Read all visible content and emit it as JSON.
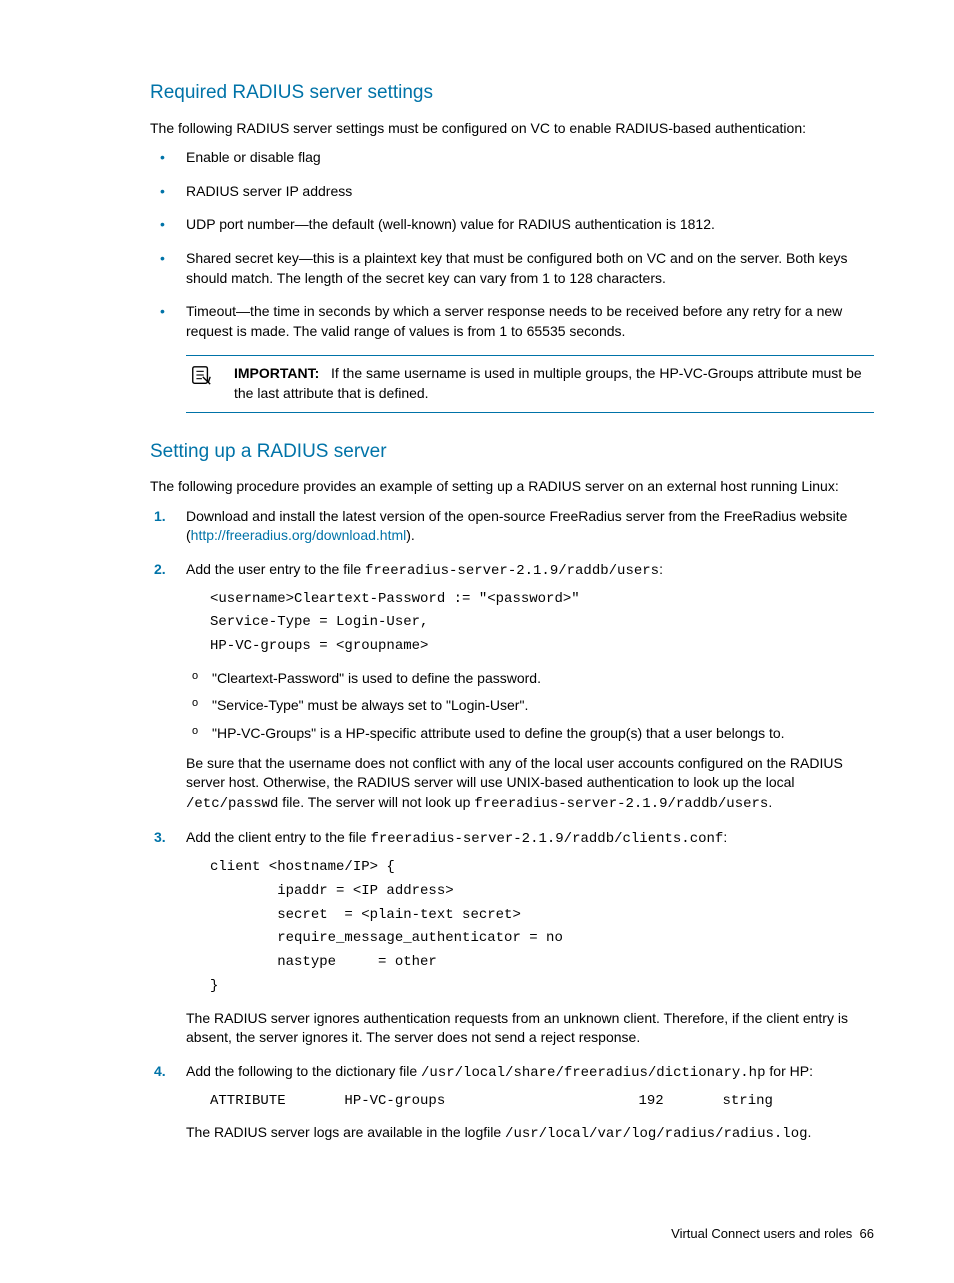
{
  "section1": {
    "heading": "Required RADIUS server settings",
    "intro": "The following RADIUS server settings must be configured on VC to enable RADIUS-based authentication:",
    "bullets": [
      "Enable or disable flag",
      "RADIUS server IP address",
      "UDP port number—the default (well-known) value for RADIUS authentication is 1812.",
      "Shared secret key—this is a plaintext key that must be configured both on VC and on the server. Both keys should match. The length of the secret key can vary from 1 to 128 characters.",
      "Timeout—the time in seconds by which a server response needs to be received before any retry for a new request is made. The valid range of values is from 1 to 65535 seconds."
    ],
    "note_label": "IMPORTANT:",
    "note_text": "If the same username is used in multiple groups, the HP-VC-Groups attribute must be the last attribute that is defined."
  },
  "section2": {
    "heading": "Setting up a RADIUS server",
    "intro": "The following procedure provides an example of setting up a RADIUS server on an external host running Linux:",
    "step1_pre": "Download and install the latest version of the open-source FreeRadius server from the FreeRadius website (",
    "step1_link": "http://freeradius.org/download.html",
    "step1_post": ").",
    "step2_pre": "Add the user entry to the file ",
    "step2_file": "freeradius-server-2.1.9/raddb/users",
    "step2_post": ":",
    "step2_code": "<username>Cleartext-Password := \"<password>\"\nService-Type = Login-User,\nHP-VC-groups = <groupname>",
    "step2_sub": [
      "\"Cleartext-Password\" is used to define the password.",
      "\"Service-Type\" must be always set to \"Login-User\".",
      "\"HP-VC-Groups\" is a HP-specific attribute used to define the group(s) that a user belongs to."
    ],
    "step2_para_a": "Be sure that the username does not conflict with any of the local user accounts configured on the RADIUS server host. Otherwise, the RADIUS server will use UNIX-based authentication to look up the local ",
    "step2_para_b": "/etc/passwd",
    "step2_para_c": " file. The server will not look up ",
    "step2_para_d": "freeradius-server-2.1.9/raddb/users",
    "step2_para_e": ".",
    "step3_pre": "Add the client entry to the file ",
    "step3_file": "freeradius-server-2.1.9/raddb/clients.conf",
    "step3_post": ":",
    "step3_code": "client <hostname/IP> {\n        ipaddr = <IP address>\n        secret  = <plain-text secret>\n        require_message_authenticator = no\n        nastype     = other\n}",
    "step3_para": "The RADIUS server ignores authentication requests from an unknown client. Therefore, if the client entry is absent, the server ignores it. The server does not send a reject response.",
    "step4_pre": "Add the following to the dictionary file ",
    "step4_file": "/usr/local/share/freeradius/dictionary.hp",
    "step4_post": " for HP:",
    "step4_code": "ATTRIBUTE       HP-VC-groups                       192       string",
    "step4_para_a": "The RADIUS server logs are available in the logfile ",
    "step4_para_b": "/usr/local/var/log/radius/radius.log",
    "step4_para_c": "."
  },
  "footer": {
    "text": "Virtual Connect users and roles",
    "page": "66"
  }
}
